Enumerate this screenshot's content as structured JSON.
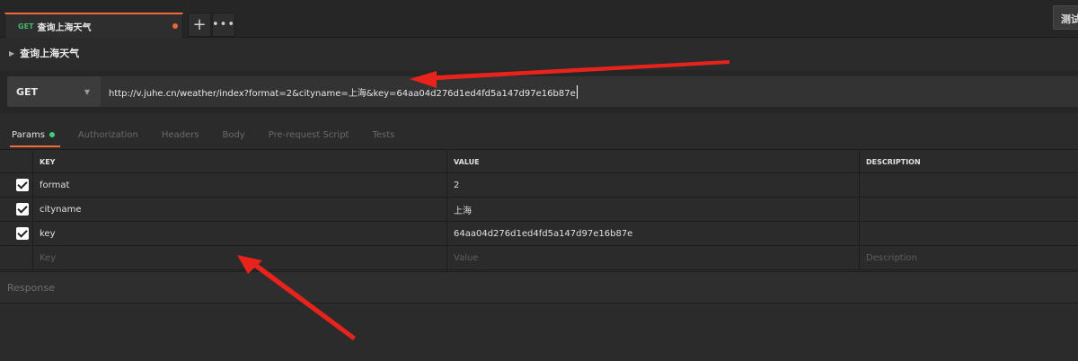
{
  "tabs": {
    "active_tab": {
      "method": "GET",
      "name": "查询上海天气"
    },
    "add_label": "+",
    "more_label": "•••",
    "top_right_button": "测试"
  },
  "request": {
    "name": "查询上海天气",
    "method": "GET",
    "url": "http://v.juhe.cn/weather/index?format=2&cityname=上海&key=64aa04d276d1ed4fd5a147d97e16b87e"
  },
  "subtabs": [
    "Params",
    "Authorization",
    "Headers",
    "Body",
    "Pre-request Script",
    "Tests"
  ],
  "params": {
    "headers": [
      "KEY",
      "VALUE",
      "DESCRIPTION"
    ],
    "rows": [
      {
        "key": "format",
        "value": "2",
        "description": ""
      },
      {
        "key": "cityname",
        "value": "上海",
        "description": ""
      },
      {
        "key": "key",
        "value": "64aa04d276d1ed4fd5a147d97e16b87e",
        "description": ""
      }
    ],
    "placeholders": {
      "key": "Key",
      "value": "Value",
      "description": "Description"
    }
  },
  "response": {
    "label": "Response"
  },
  "colors": {
    "accent": "#f26b3a",
    "get_method": "#46b86b",
    "status_dot": "#3fcf77",
    "annotation": "#e8231c"
  },
  "icons": [
    "plus-icon",
    "more-icon",
    "caret-right-icon",
    "chevron-down-icon",
    "check-icon",
    "annotation-arrow"
  ]
}
